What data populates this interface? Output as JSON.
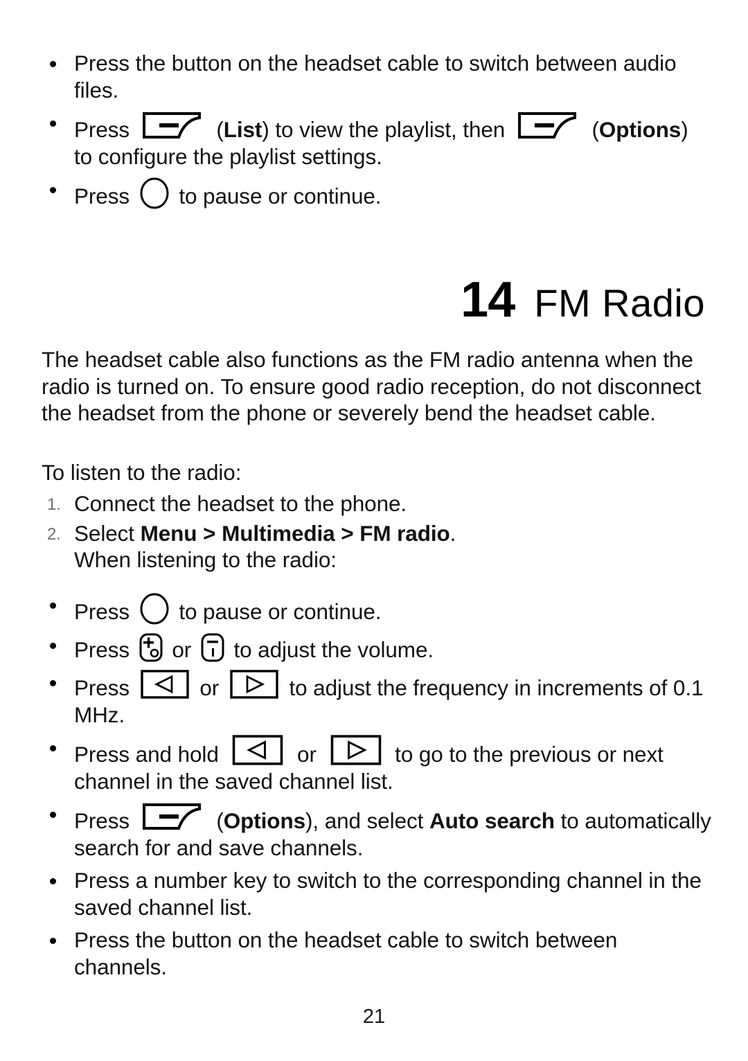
{
  "document": {
    "page_number": "21",
    "chapter": {
      "number": "14",
      "title": "FM Radio"
    }
  },
  "top_bullets": [
    {
      "id": "headset-button-audio-files",
      "segments": [
        {
          "type": "text",
          "value": "Press the button on the headset cable to switch between audio files."
        }
      ]
    },
    {
      "id": "list-options-playlist",
      "segments": [
        {
          "type": "text",
          "value": "Press "
        },
        {
          "type": "icon",
          "value": "softkey-icon"
        },
        {
          "type": "text",
          "value": " ("
        },
        {
          "type": "bold",
          "value": "List"
        },
        {
          "type": "text",
          "value": ") to view the playlist, then "
        },
        {
          "type": "icon",
          "value": "softkey-icon"
        },
        {
          "type": "text",
          "value": " ("
        },
        {
          "type": "bold",
          "value": "Options"
        },
        {
          "type": "text",
          "value": ") to configure the playlist settings."
        }
      ]
    },
    {
      "id": "ok-pause-continue",
      "segments": [
        {
          "type": "text",
          "value": "Press "
        },
        {
          "type": "icon",
          "value": "ok-key-icon"
        },
        {
          "type": "text",
          "value": " to pause or continue."
        }
      ]
    }
  ],
  "intro_paragraph": "The headset cable also functions as the FM radio antenna when the radio is turned on. To ensure good radio reception, do not disconnect the headset from the phone or severely bend the headset cable.",
  "listen_lead_in": "To listen to the radio:",
  "steps": [
    {
      "marker": "1.",
      "lines": [
        {
          "segments": [
            {
              "type": "text",
              "value": "Connect the headset to the phone."
            }
          ]
        }
      ]
    },
    {
      "marker": "2.",
      "lines": [
        {
          "segments": [
            {
              "type": "text",
              "value": "Select "
            },
            {
              "type": "bold",
              "value": "Menu"
            },
            {
              "type": "bold",
              "value": " > "
            },
            {
              "type": "bold",
              "value": "Multimedia"
            },
            {
              "type": "bold",
              "value": " > "
            },
            {
              "type": "bold",
              "value": "FM radio"
            },
            {
              "type": "text",
              "value": "."
            }
          ]
        },
        {
          "segments": [
            {
              "type": "text",
              "value": "When listening to the radio:"
            }
          ]
        }
      ]
    }
  ],
  "radio_bullets": [
    {
      "id": "ok-pause-continue-radio",
      "segments": [
        {
          "type": "text",
          "value": "Press "
        },
        {
          "type": "icon",
          "value": "ok-key-icon"
        },
        {
          "type": "text",
          "value": " to pause or continue."
        }
      ]
    },
    {
      "id": "volume-adjust",
      "segments": [
        {
          "type": "text",
          "value": "Press "
        },
        {
          "type": "icon",
          "value": "volume-up-key-icon"
        },
        {
          "type": "text",
          "value": " or "
        },
        {
          "type": "icon",
          "value": "volume-down-key-icon"
        },
        {
          "type": "text",
          "value": " to adjust the volume."
        }
      ]
    },
    {
      "id": "frequency-adjust",
      "segments": [
        {
          "type": "text",
          "value": "Press "
        },
        {
          "type": "icon",
          "value": "arrow-left-key-icon"
        },
        {
          "type": "text",
          "value": " or "
        },
        {
          "type": "icon",
          "value": "arrow-right-key-icon"
        },
        {
          "type": "text",
          "value": " to adjust the frequency in increments of 0.1 MHz."
        }
      ]
    },
    {
      "id": "channel-prev-next",
      "segments": [
        {
          "type": "text",
          "value": "Press and hold "
        },
        {
          "type": "icon",
          "value": "arrow-left-key-icon-lg"
        },
        {
          "type": "text",
          "value": " or "
        },
        {
          "type": "icon",
          "value": "arrow-right-key-icon-lg"
        },
        {
          "type": "text",
          "value": " to go to the previous or next channel in the saved channel list."
        }
      ]
    },
    {
      "id": "auto-search",
      "segments": [
        {
          "type": "text",
          "value": "Press "
        },
        {
          "type": "icon",
          "value": "softkey-icon"
        },
        {
          "type": "text",
          "value": " ("
        },
        {
          "type": "bold",
          "value": "Options"
        },
        {
          "type": "text",
          "value": "), and select "
        },
        {
          "type": "bold",
          "value": "Auto search"
        },
        {
          "type": "text",
          "value": " to automatically search for and save channels."
        }
      ]
    },
    {
      "id": "number-key-channel",
      "segments": [
        {
          "type": "text",
          "value": "Press a number key to switch to the corresponding channel in the saved channel list."
        }
      ]
    },
    {
      "id": "headset-button-channels",
      "segments": [
        {
          "type": "text",
          "value": "Press the button on the headset cable to switch between channels."
        }
      ]
    }
  ],
  "icon_labels": {
    "softkey": "softkey-icon",
    "ok_key": "ok-key-icon",
    "volume_up": "volume-up-key-icon",
    "volume_down": "volume-down-key-icon",
    "arrow_left": "arrow-left-key-icon",
    "arrow_right": "arrow-right-key-icon"
  },
  "colors": {
    "text": "#121212",
    "marker": "#6f6f6f",
    "page_background": "#ffffff"
  }
}
